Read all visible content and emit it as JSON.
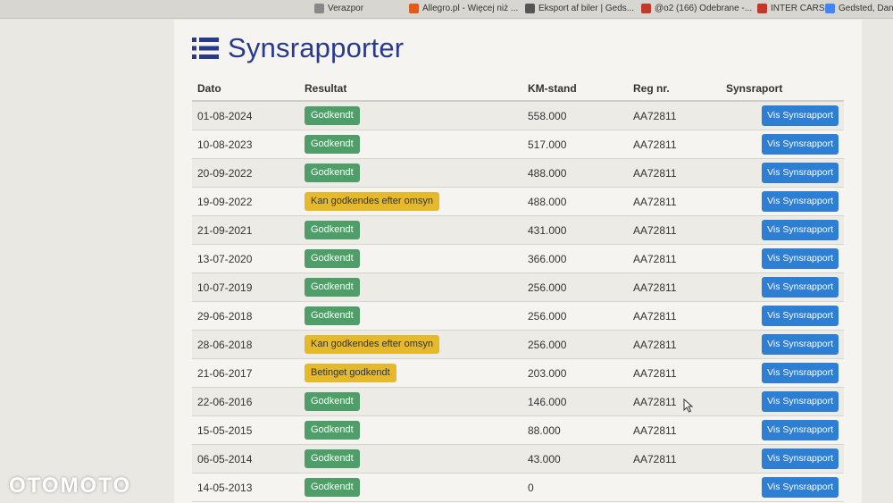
{
  "bookmarks": [
    {
      "label": "Verazpor",
      "icon": "puzzle-icon",
      "color": "#888888"
    },
    {
      "label": "Allegro.pl - Więcej niż ...",
      "icon": "allegro-icon",
      "color": "#e05a1a"
    },
    {
      "label": "Eksport af biler | Geds...",
      "icon": "globe-icon",
      "color": "#555555"
    },
    {
      "label": "@o2 (166) Odebrane -...",
      "icon": "o2-icon",
      "color": "#c0392b"
    },
    {
      "label": "INTER CARS",
      "icon": "intercars-icon",
      "color": "#c0392b"
    },
    {
      "label": "Gedsted, Dania",
      "icon": "google-icon",
      "color": "#4285f4"
    }
  ],
  "page": {
    "title": "Synsrapporter"
  },
  "table": {
    "headers": {
      "date": "Dato",
      "result": "Resultat",
      "km": "KM-stand",
      "reg": "Reg nr.",
      "report": "Synsraport"
    },
    "button_label": "Vis Synsrapport",
    "rows": [
      {
        "date": "01-08-2024",
        "result": "Godkendt",
        "status": "green",
        "km": "558.000",
        "reg": "AA72811"
      },
      {
        "date": "10-08-2023",
        "result": "Godkendt",
        "status": "green",
        "km": "517.000",
        "reg": "AA72811"
      },
      {
        "date": "20-09-2022",
        "result": "Godkendt",
        "status": "green",
        "km": "488.000",
        "reg": "AA72811"
      },
      {
        "date": "19-09-2022",
        "result": "Kan godkendes efter omsyn",
        "status": "yellow",
        "km": "488.000",
        "reg": "AA72811"
      },
      {
        "date": "21-09-2021",
        "result": "Godkendt",
        "status": "green",
        "km": "431.000",
        "reg": "AA72811"
      },
      {
        "date": "13-07-2020",
        "result": "Godkendt",
        "status": "green",
        "km": "366.000",
        "reg": "AA72811"
      },
      {
        "date": "10-07-2019",
        "result": "Godkendt",
        "status": "green",
        "km": "256.000",
        "reg": "AA72811"
      },
      {
        "date": "29-06-2018",
        "result": "Godkendt",
        "status": "green",
        "km": "256.000",
        "reg": "AA72811"
      },
      {
        "date": "28-06-2018",
        "result": "Kan godkendes efter omsyn",
        "status": "yellow",
        "km": "256.000",
        "reg": "AA72811"
      },
      {
        "date": "21-06-2017",
        "result": "Betinget godkendt",
        "status": "yellow",
        "km": "203.000",
        "reg": "AA72811"
      },
      {
        "date": "22-06-2016",
        "result": "Godkendt",
        "status": "green",
        "km": "146.000",
        "reg": "AA72811"
      },
      {
        "date": "15-05-2015",
        "result": "Godkendt",
        "status": "green",
        "km": "88.000",
        "reg": "AA72811"
      },
      {
        "date": "06-05-2014",
        "result": "Godkendt",
        "status": "green",
        "km": "43.000",
        "reg": "AA72811"
      },
      {
        "date": "14-05-2013",
        "result": "Godkendt",
        "status": "green",
        "km": "0",
        "reg": ""
      }
    ]
  },
  "watermark": "OTOMOTO",
  "colors": {
    "title": "#283a8c",
    "badge_green": "#4f9e6a",
    "badge_yellow": "#e5b92c",
    "button": "#2e7fd4"
  }
}
